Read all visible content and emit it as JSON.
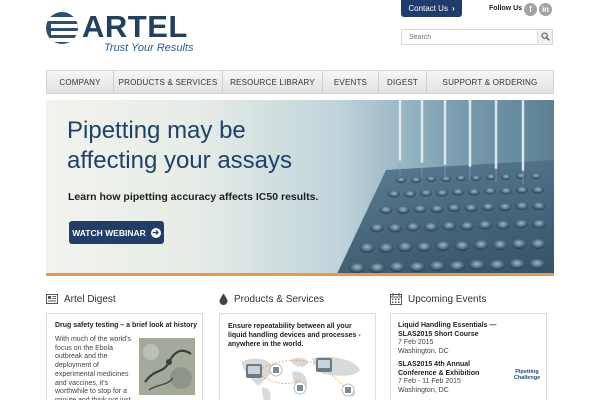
{
  "brand": {
    "name": "ARTEL",
    "tagline": "Trust Your Results"
  },
  "header": {
    "contact_label": "Contact Us",
    "follow_label": "Follow Us",
    "social": [
      {
        "name": "facebook",
        "glyph": "f"
      },
      {
        "name": "linkedin",
        "glyph": "in"
      }
    ],
    "search_placeholder": "Search"
  },
  "nav": {
    "items": [
      {
        "label": "COMPANY"
      },
      {
        "label": "PRODUCTS & SERVICES"
      },
      {
        "label": "RESOURCE LIBRARY"
      },
      {
        "label": "EVENTS"
      },
      {
        "label": "DIGEST"
      },
      {
        "label": "SUPPORT & ORDERING"
      }
    ]
  },
  "hero": {
    "title_line1": "Pipetting may be",
    "title_line2": "affecting your assays",
    "subtitle": "Learn how pipetting accuracy affects IC50 results.",
    "button_label": "WATCH WEBINAR"
  },
  "digest": {
    "heading": "Artel Digest",
    "article_title": "Drug safety testing – a brief look at history",
    "article_excerpt": "With much of the world's focus on the Ebola outbreak and the deployment of experimental medicines and vaccines, it's worthwhile to stop for a minute and think not just about drug and"
  },
  "products": {
    "heading": "Products & Services",
    "text": "Ensure repeatability between all your liquid handling devices and processes - anywhere in the world."
  },
  "events": {
    "heading": "Upcoming Events",
    "items": [
      {
        "title": "Liquid Handling Essentials — SLAS2015 Short Course",
        "date": "7 Feb 2015",
        "location": "Washington, DC"
      },
      {
        "title": "SLAS2015 4th Annual Conference & Exhibition",
        "date": "7 Feb - 11 Feb 2015",
        "location": "Washington, DC"
      }
    ],
    "logo_text_1": "Pipetting",
    "logo_text_2": "Challenge"
  },
  "colors": {
    "brand_navy": "#23415e",
    "button_navy": "#213d68",
    "hero_accent": "#e59a4a"
  }
}
